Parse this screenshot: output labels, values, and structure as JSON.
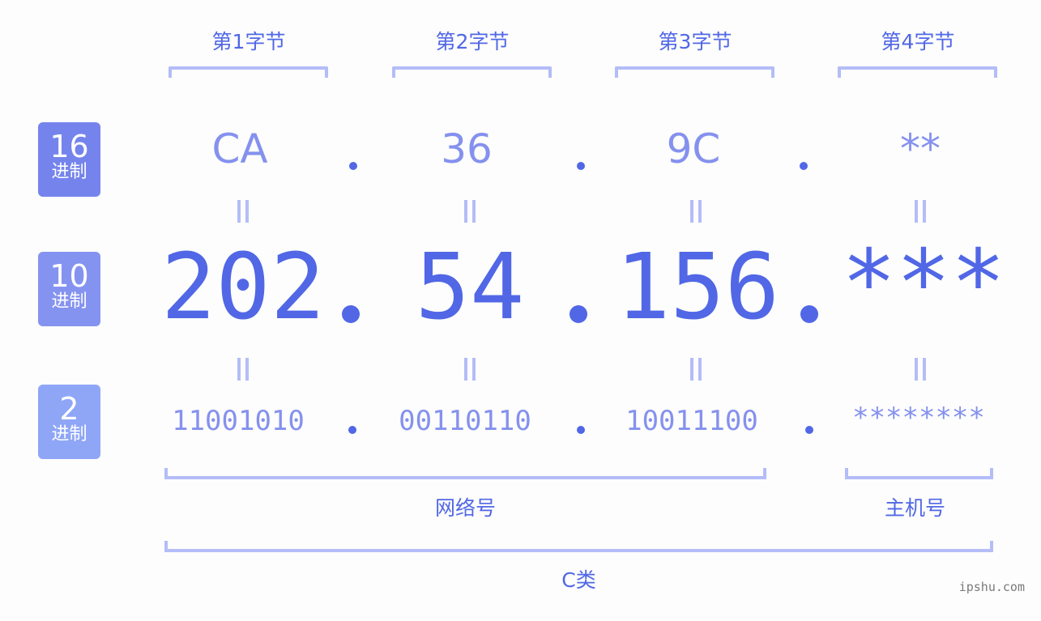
{
  "bytes": [
    {
      "label": "第1字节",
      "hex": "CA",
      "dec": "202",
      "bin": "11001010"
    },
    {
      "label": "第2字节",
      "hex": "36",
      "dec": "54",
      "bin": "00110110"
    },
    {
      "label": "第3字节",
      "hex": "9C",
      "dec": "156",
      "bin": "10011100"
    },
    {
      "label": "第4字节",
      "hex": "**",
      "dec": "***",
      "bin": "********"
    }
  ],
  "separator": ".",
  "badges": {
    "hex": {
      "num": "16",
      "unit": "进制",
      "color": "#7584ec"
    },
    "dec": {
      "num": "10",
      "unit": "进制",
      "color": "#8593f0"
    },
    "bin": {
      "num": "2",
      "unit": "进制",
      "color": "#8fa6f7"
    }
  },
  "groups": {
    "network": "网络号",
    "host": "主机号",
    "class": "C类"
  },
  "watermark": "ipshu.com",
  "colors": {
    "accent": "#5167e6",
    "light": "#8591ee",
    "bracket": "#b4bdf8"
  }
}
